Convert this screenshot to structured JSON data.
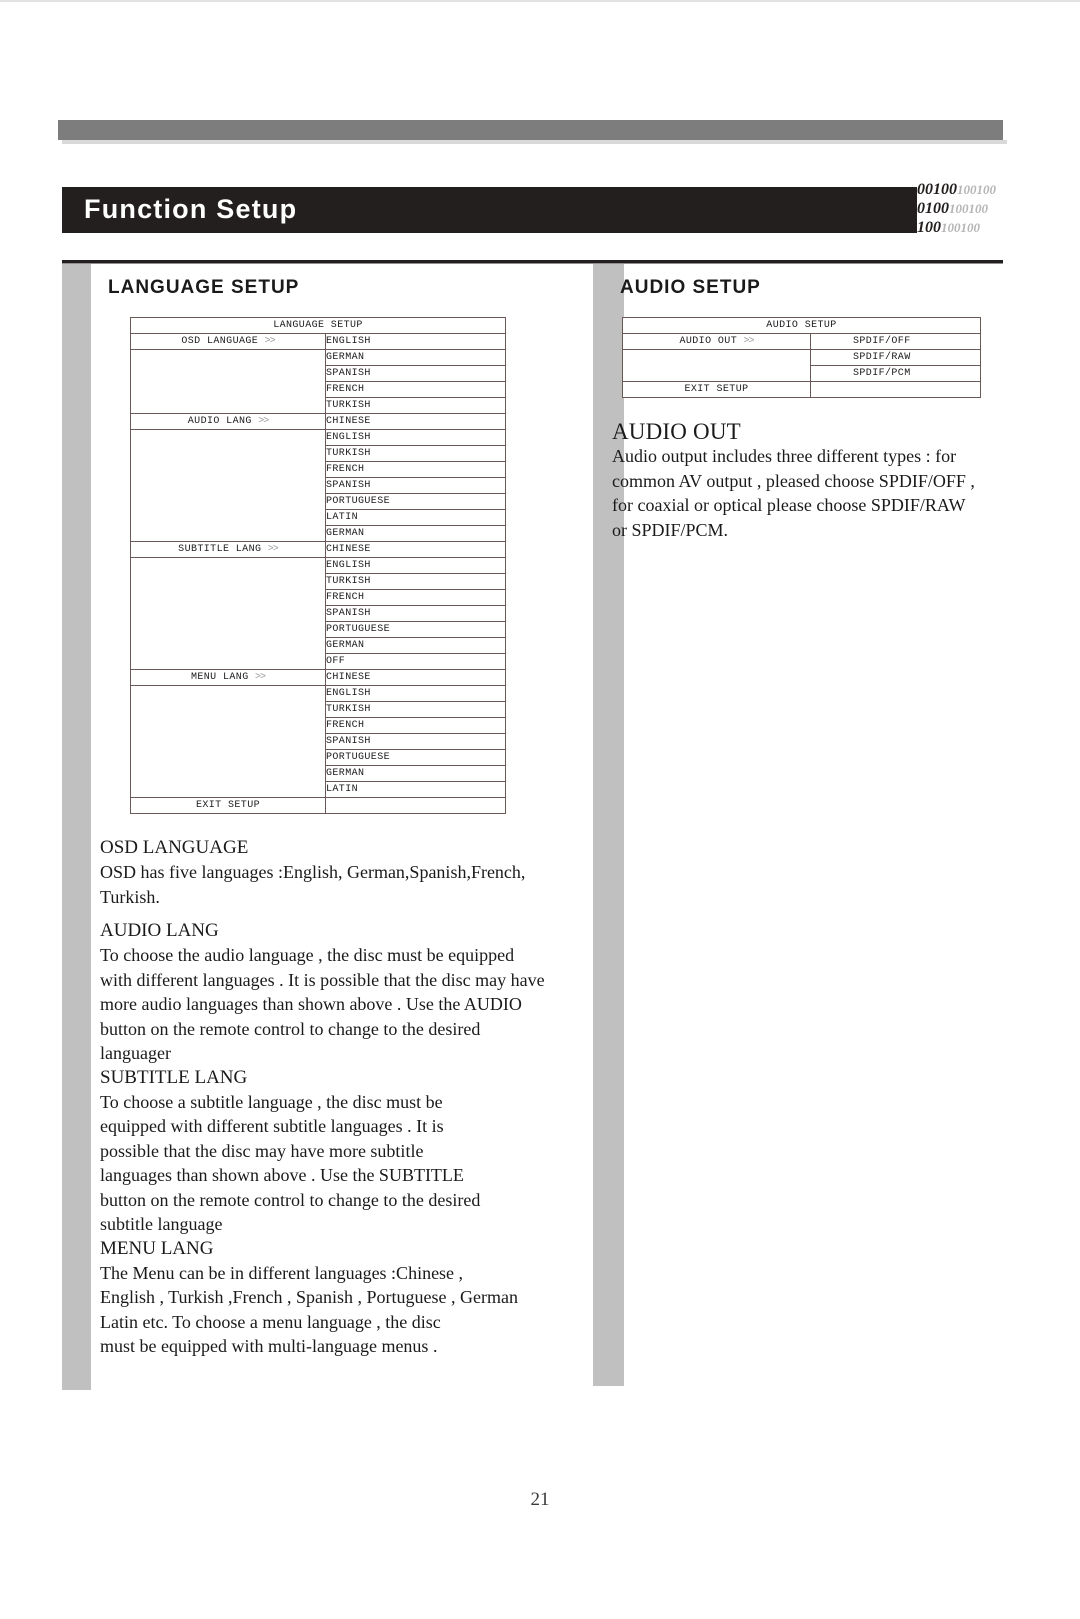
{
  "header": {
    "title": "Function Setup",
    "binary_deco": [
      "00100100100",
      "0100100100",
      "100100100"
    ]
  },
  "left_column": {
    "section_heading": "LANGUAGE  SETUP",
    "osd_menu": {
      "title": "LANGUAGE SETUP",
      "groups": [
        {
          "label": "OSD LANGUAGE",
          "chevron": ">>",
          "options": [
            "ENGLISH",
            "GERMAN",
            "SPANISH",
            "FRENCH",
            "TURKISH"
          ]
        },
        {
          "label": "AUDIO LANG",
          "chevron": ">>",
          "options": [
            "CHINESE",
            "ENGLISH",
            "TURKISH",
            "FRENCH",
            "SPANISH",
            "PORTUGUESE",
            "LATIN",
            "GERMAN"
          ]
        },
        {
          "label": "SUBTITLE LANG",
          "chevron": ">>",
          "options": [
            "CHINESE",
            "ENGLISH",
            "TURKISH",
            "FRENCH",
            "SPANISH",
            "PORTUGUESE",
            "GERMAN",
            "OFF"
          ]
        },
        {
          "label": "MENU LANG",
          "chevron": ">>",
          "options": [
            "CHINESE",
            "ENGLISH",
            "TURKISH",
            "FRENCH",
            "SPANISH",
            "PORTUGUESE",
            "GERMAN",
            "LATIN"
          ]
        }
      ],
      "exit_label": "EXIT SETUP"
    },
    "topics": [
      {
        "heading": "OSD LANGUAGE",
        "lines": [
          "OSD has five  languages :English, German,Spanish,French,",
          "Turkish."
        ]
      },
      {
        "heading": "AUDIO LANG",
        "lines": [
          "To choose the audio language , the disc must be equipped",
          "with different languages . It is possible that the disc may have",
          "more audio languages than shown above . Use the AUDIO",
          "button on the remote control to change to the desired",
          "languager"
        ]
      },
      {
        "heading": "SUBTITLE  LANG",
        "lines": [
          "To choose a subtitle language , the disc must be",
          "equipped with different subtitle languages . It is",
          " possible that the disc may have more subtitle",
          "languages than shown above . Use the SUBTITLE",
          "button on the remote control to change to the desired",
          "subtitle language"
        ]
      },
      {
        "heading": "MENU LANG",
        "lines": [
          "The Menu can be in different languages  :Chinese ,",
          "English , Turkish ,French ,  Spanish , Portuguese , German",
          "Latin  etc. To choose a menu language , the disc",
          "must be equipped with multi-language menus ."
        ]
      }
    ]
  },
  "right_column": {
    "section_heading": "AUDIO SETUP",
    "osd_menu": {
      "title": "AUDIO SETUP",
      "groups": [
        {
          "label": "AUDIO OUT",
          "chevron": ">>",
          "options": [
            "SPDIF/OFF",
            "SPDIF/RAW",
            "SPDIF/PCM"
          ]
        }
      ],
      "exit_label": "EXIT SETUP"
    },
    "topics": [
      {
        "heading": "AUDIO OUT",
        "lines": [
          "Audio output includes three different types : for",
          "common AV output , pleased choose SPDIF/OFF ,",
          "for coaxial or optical please choose SPDIF/RAW",
          "or SPDIF/PCM."
        ]
      }
    ]
  },
  "footer": {
    "page_number": "21"
  },
  "colors": {
    "banner_bg": "#231f1e",
    "bar_grey": "#7d7d7d",
    "column_grey": "#c0c0c0",
    "table_border": "#6a5a57"
  }
}
